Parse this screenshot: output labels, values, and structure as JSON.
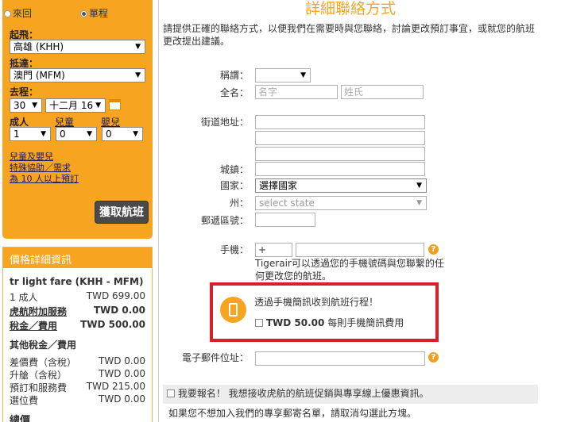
{
  "search": {
    "trip_types": [
      "來回",
      "單程"
    ],
    "selected_trip": "單程",
    "from_label": "起飛：",
    "from_value": "高雄 (KHH)",
    "to_label": "抵達：",
    "to_value": "澳門 (MFM)",
    "depart_label": "去程：",
    "depart_day": "30",
    "depart_month": "十二月 16",
    "adults_label": "成人",
    "children_label": "兒童",
    "infants_label": "嬰兒",
    "adults_value": "1",
    "children_value": "0",
    "infants_value": "0",
    "links": [
      "兒童及嬰兒",
      "特殊協助／需求",
      "為 10 人以上預訂"
    ],
    "search_button": "獲取航班"
  },
  "price": {
    "header": "價格詳細資訊",
    "fare_title": "tr light fare (KHH - MFM)",
    "rows": [
      {
        "label": "1 成人",
        "amount": "TWD  699.00"
      },
      {
        "label": "虎航附加服務",
        "amount": "TWD  0.00"
      },
      {
        "label": "稅金／費用",
        "amount": "TWD  500.00"
      }
    ],
    "other_title": "其他稅金／費用",
    "other_rows": [
      {
        "label": "差價費（含稅）",
        "amount": "TWD  0.00"
      },
      {
        "label": "升艙（含稅）",
        "amount": "TWD  0.00"
      },
      {
        "label": "預訂和服務費",
        "amount": "TWD  215.00"
      },
      {
        "label": "選位費",
        "amount": "TWD  0.00"
      }
    ],
    "total_label": "總價"
  },
  "contact": {
    "title": "詳細聯絡方式",
    "intro": "請提供正確的聯絡方式，以便我們在需要時與您聯絡，討論更改預訂事宜，或就您的航班更改提出建議。",
    "salutation_label": "稱謂：",
    "fullname_label": "全名：",
    "first_name_placeholder": "名字",
    "last_name_placeholder": "姓氏",
    "street_label": "街道地址：",
    "city_label": "城鎮：",
    "country_label": "國家：",
    "country_value": "選擇國家",
    "state_label": "州：",
    "state_value": "select state",
    "postcode_label": "郵遞區號：",
    "mobile_label": "手機：",
    "mobile_prefix": "+",
    "mobile_note": "Tigerair可以透過您的手機號碼與您聯繫的任何更改您的航班。",
    "sms_title": "透過手機簡訊收到航班行程！",
    "sms_price": "TWD 50.00",
    "sms_desc": "每則手機簡訊費用",
    "email_label": "電子郵件位址：",
    "newsletter_bold": "我要報名！",
    "newsletter_text": "我想接收虎航的航班促銷與專享線上優惠資訊。",
    "optout": "如果您不想加入我們的專享郵寄名單，請取消勾選此方塊。"
  },
  "colors": {
    "accent": "#f7a521",
    "highlight_border": "#d7202a",
    "button_dark": "#4a4a4a"
  }
}
